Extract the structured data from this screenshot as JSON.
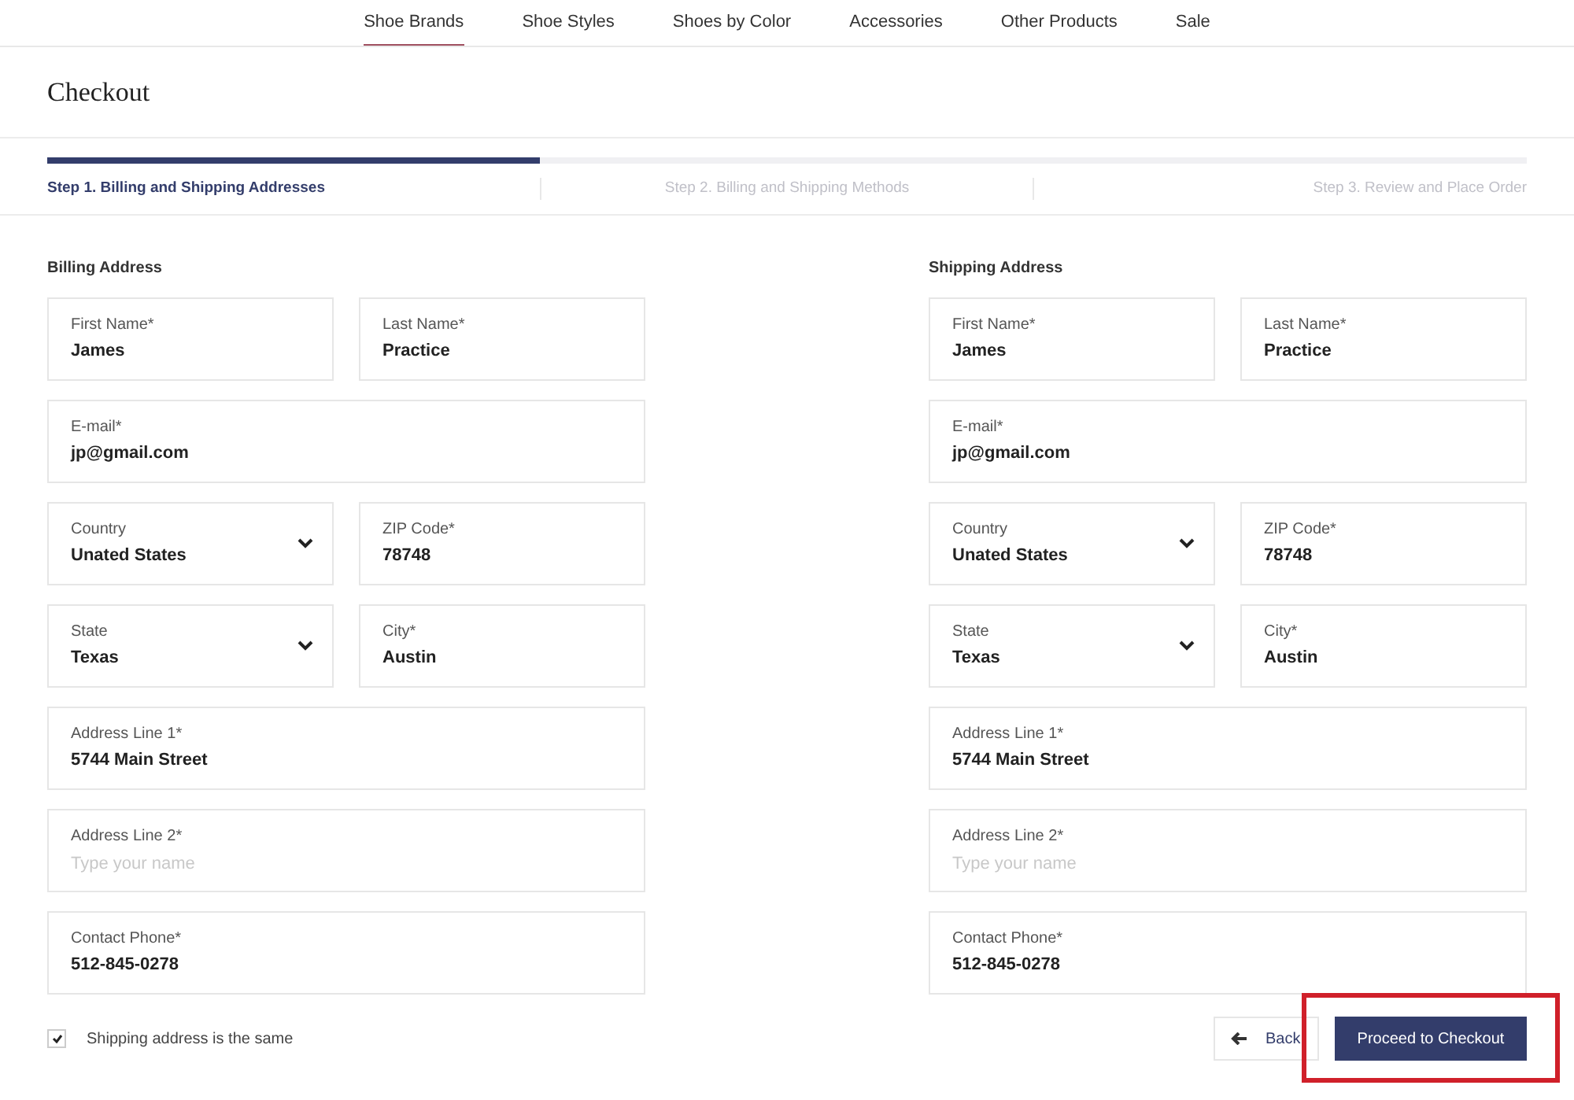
{
  "nav": [
    {
      "label": "Shoe Brands",
      "selected": true
    },
    {
      "label": "Shoe Styles",
      "selected": false
    },
    {
      "label": "Shoes by Color",
      "selected": false
    },
    {
      "label": "Accessories",
      "selected": false
    },
    {
      "label": "Other Products",
      "selected": false
    },
    {
      "label": "Sale",
      "selected": false
    }
  ],
  "page_title": "Checkout",
  "progress": {
    "level": 0.333
  },
  "steps": [
    {
      "label": "Step 1. Billing and Shipping Addresses",
      "selected": true
    },
    {
      "label": "Step 2. Billing and Shipping Methods",
      "selected": false
    },
    {
      "label": "Step 3. Review and Place Order",
      "selected": false
    }
  ],
  "sections": [
    {
      "title": "Billing Address",
      "rows": [
        [
          {
            "kind": "text",
            "label": "First Name*",
            "value": "James"
          },
          {
            "kind": "text",
            "label": "Last Name*",
            "value": "Practice"
          }
        ],
        [
          {
            "kind": "text",
            "label": "E-mail*",
            "value": "jp@gmail.com"
          }
        ],
        [
          {
            "kind": "select",
            "label": "Country",
            "value": "Unated States"
          },
          {
            "kind": "text",
            "label": "ZIP Code*",
            "value": "78748"
          }
        ],
        [
          {
            "kind": "select",
            "label": "State",
            "value": "Texas"
          },
          {
            "kind": "text",
            "label": "City*",
            "value": "Austin"
          }
        ],
        [
          {
            "kind": "text",
            "label": "Address Line 1*",
            "value": "5744 Main Street"
          }
        ],
        [
          {
            "kind": "text",
            "label": "Address Line 2*",
            "placeholder": "Type your name"
          }
        ],
        [
          {
            "kind": "text",
            "label": "Contact Phone*",
            "value": "512-845-0278"
          }
        ]
      ]
    },
    {
      "title": "Shipping Address",
      "rows": [
        [
          {
            "kind": "text",
            "label": "First Name*",
            "value": "James"
          },
          {
            "kind": "text",
            "label": "Last Name*",
            "value": "Practice"
          }
        ],
        [
          {
            "kind": "text",
            "label": "E-mail*",
            "value": "jp@gmail.com"
          }
        ],
        [
          {
            "kind": "select",
            "label": "Country",
            "value": "Unated States"
          },
          {
            "kind": "text",
            "label": "ZIP Code*",
            "value": "78748"
          }
        ],
        [
          {
            "kind": "select",
            "label": "State",
            "value": "Texas"
          },
          {
            "kind": "text",
            "label": "City*",
            "value": "Austin"
          }
        ],
        [
          {
            "kind": "text",
            "label": "Address Line 1*",
            "value": "5744 Main Street"
          }
        ],
        [
          {
            "kind": "text",
            "label": "Address Line 2*",
            "placeholder": "Type your name"
          }
        ],
        [
          {
            "kind": "text",
            "label": "Contact Phone*",
            "value": "512-845-0278"
          }
        ]
      ]
    }
  ],
  "same_address": {
    "label": "Shipping address is the same",
    "checked": true
  },
  "back_button": {
    "label": "Back"
  },
  "proceed_button": {
    "label": "Proceed to Checkout",
    "highlighted": true
  }
}
